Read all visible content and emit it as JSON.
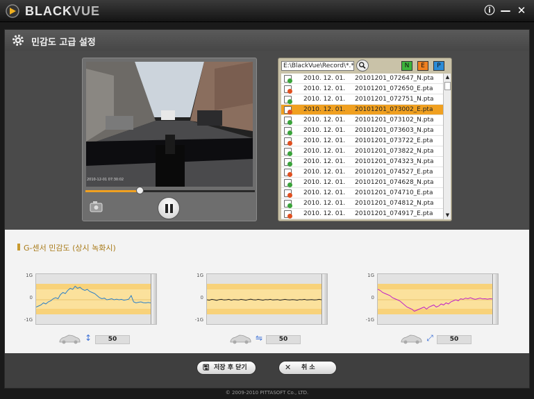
{
  "window": {
    "brand_main": "BLACK",
    "brand_accent": "VUE",
    "info_label": "ⓘ",
    "minimize_label": "—",
    "close_label": "✕"
  },
  "header": {
    "title": "민감도 고급 설정"
  },
  "player": {
    "timestamp": "2010-12-01 07:30:02",
    "progress_percent": 32
  },
  "files": {
    "path": "E:\\BlackVue\\Record\\*.*",
    "filters": [
      "N",
      "E",
      "P"
    ],
    "selected_index": 3,
    "rows": [
      {
        "date": "2010. 12. 01.",
        "name": "20101201_072647_N.pta",
        "type": "N"
      },
      {
        "date": "2010. 12. 01.",
        "name": "20101201_072650_E.pta",
        "type": "E"
      },
      {
        "date": "2010. 12. 01.",
        "name": "20101201_072751_N.pta",
        "type": "N"
      },
      {
        "date": "2010. 12. 01.",
        "name": "20101201_073002_E.pta",
        "type": "E"
      },
      {
        "date": "2010. 12. 01.",
        "name": "20101201_073102_N.pta",
        "type": "N"
      },
      {
        "date": "2010. 12. 01.",
        "name": "20101201_073603_N.pta",
        "type": "N"
      },
      {
        "date": "2010. 12. 01.",
        "name": "20101201_073722_E.pta",
        "type": "E"
      },
      {
        "date": "2010. 12. 01.",
        "name": "20101201_073822_N.pta",
        "type": "N"
      },
      {
        "date": "2010. 12. 01.",
        "name": "20101201_074323_N.pta",
        "type": "N"
      },
      {
        "date": "2010. 12. 01.",
        "name": "20101201_074527_E.pta",
        "type": "E"
      },
      {
        "date": "2010. 12. 01.",
        "name": "20101201_074628_N.pta",
        "type": "N"
      },
      {
        "date": "2010. 12. 01.",
        "name": "20101201_074710_E.pta",
        "type": "E"
      },
      {
        "date": "2010. 12. 01.",
        "name": "20101201_074812_N.pta",
        "type": "N"
      },
      {
        "date": "2010. 12. 01.",
        "name": "20101201_074917_E.pta",
        "type": "E"
      }
    ]
  },
  "gsensor": {
    "title": "G-센서 민감도 (상시 녹화시)",
    "charts": [
      {
        "axis": "vertical",
        "value": "50",
        "color": "#2a7fc8",
        "ticks": [
          "1G",
          "0",
          "-1G"
        ],
        "samples": [
          -0.35,
          -0.3,
          -0.25,
          -0.15,
          -0.2,
          -0.1,
          -0.05,
          0.05,
          0.1,
          0.05,
          0.25,
          0.35,
          0.3,
          0.45,
          0.55,
          0.5,
          0.65,
          0.55,
          0.6,
          0.5,
          0.45,
          0.5,
          0.4,
          0.35,
          0.3,
          0.2,
          0.1,
          0.05,
          0.08,
          0.0,
          0.02,
          0.05,
          0.0,
          0.03,
          0.0,
          0.02,
          -0.02,
          0.0,
          0.03,
          0.2,
          -0.1,
          -0.15,
          -0.12,
          -0.1,
          -0.14,
          -0.15,
          -0.13,
          -0.15
        ]
      },
      {
        "axis": "horizontal",
        "value": "50",
        "color": "#222222",
        "ticks": [
          "1G",
          "0",
          "-1G"
        ],
        "samples": [
          0.0,
          -0.02,
          0.02,
          0.0,
          -0.03,
          0.01,
          0.02,
          -0.01,
          0.0,
          0.02,
          -0.02,
          0.01,
          0.0,
          -0.01,
          0.02,
          0.0,
          -0.02,
          0.01,
          0.03,
          0.0,
          -0.01,
          0.02,
          0.0,
          -0.02,
          0.01,
          0.0,
          0.02,
          -0.01,
          0.0,
          0.01,
          -0.02,
          0.0,
          0.02,
          0.0,
          -0.01,
          0.01,
          0.0,
          -0.02,
          0.01,
          0.0,
          0.02,
          -0.01,
          0.0,
          0.01,
          -0.01,
          0.0,
          0.02,
          0.0
        ]
      },
      {
        "axis": "diagonal",
        "value": "50",
        "color": "#c020c8",
        "ticks": [
          "1G",
          "0",
          "-1G"
        ],
        "samples": [
          0.5,
          0.45,
          0.35,
          0.3,
          0.25,
          0.2,
          0.1,
          0.05,
          0.0,
          -0.05,
          -0.15,
          -0.25,
          -0.35,
          -0.4,
          -0.45,
          -0.55,
          -0.5,
          -0.45,
          -0.4,
          -0.35,
          -0.45,
          -0.35,
          -0.3,
          -0.25,
          -0.35,
          -0.3,
          -0.2,
          -0.25,
          -0.15,
          -0.2,
          -0.1,
          -0.05,
          0.0,
          -0.05,
          0.05,
          0.02,
          0.08,
          0.05,
          0.1,
          0.05,
          0.02,
          0.05,
          0.08,
          0.04,
          0.05,
          0.03,
          0.05,
          0.04
        ]
      }
    ]
  },
  "actions": {
    "save_close_icon": "🖫",
    "save_close": "저장 후 닫기",
    "cancel_icon": "✕",
    "cancel": "취 소"
  },
  "footer": {
    "copyright": "© 2009-2010 PITTASOFT Co., LTD."
  },
  "colors": {
    "accent": "#f0a020",
    "normal_file": "#3aa33a",
    "event_file": "#e05020",
    "filter_n": "#3cb43c",
    "filter_e": "#f08020",
    "filter_p": "#2b8bd6"
  }
}
